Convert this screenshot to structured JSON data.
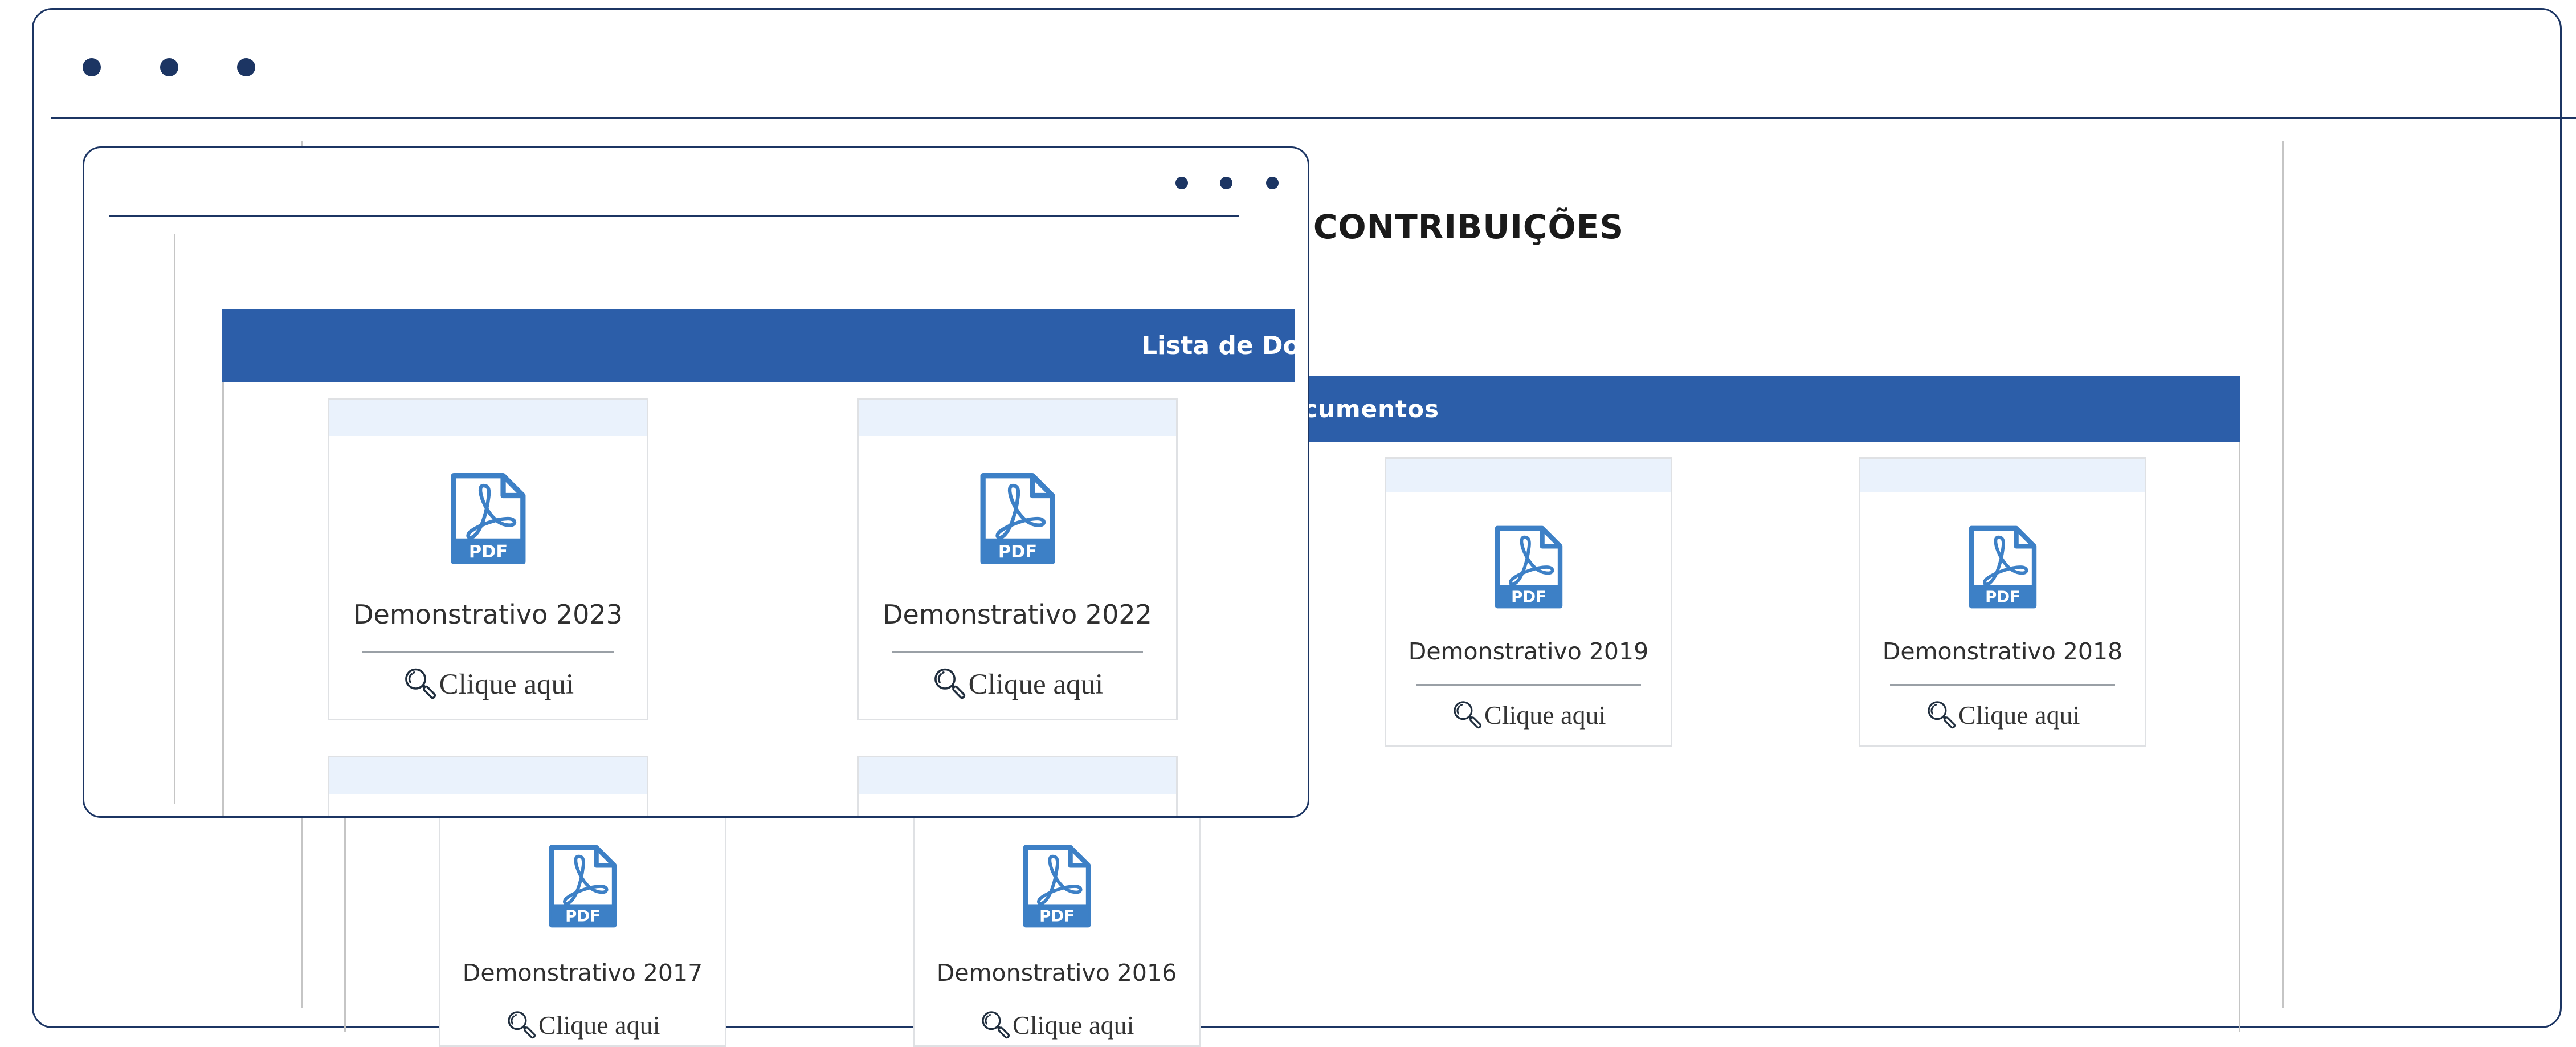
{
  "back": {
    "heading": "E CONTRIBUIÇÕES",
    "bar_title": "Lista de Documentos",
    "cards": [
      {
        "title": "Demonstrativo 2019",
        "link": "Clique aqui"
      },
      {
        "title": "Demonstrativo 2018",
        "link": "Clique aqui"
      },
      {
        "title": "Demonstrativo 2017",
        "link": "Clique aqui"
      },
      {
        "title": "Demonstrativo 2016",
        "link": "Clique aqui"
      }
    ]
  },
  "front": {
    "bar_title": "Lista de Documentos",
    "cards": [
      {
        "title": "Demonstrativo 2023",
        "link": "Clique aqui"
      },
      {
        "title": "Demonstrativo 2022",
        "link": "Clique aqui"
      }
    ]
  },
  "icons": {
    "pdf": "pdf-file-icon",
    "search": "magnifier-icon",
    "window_dots": "window-control-dots"
  },
  "colors": {
    "frame": "#1c3563",
    "header_bar": "#2c5ea9",
    "card_strip": "#eaf2fc",
    "pdf_icon": "#3d80c6"
  }
}
